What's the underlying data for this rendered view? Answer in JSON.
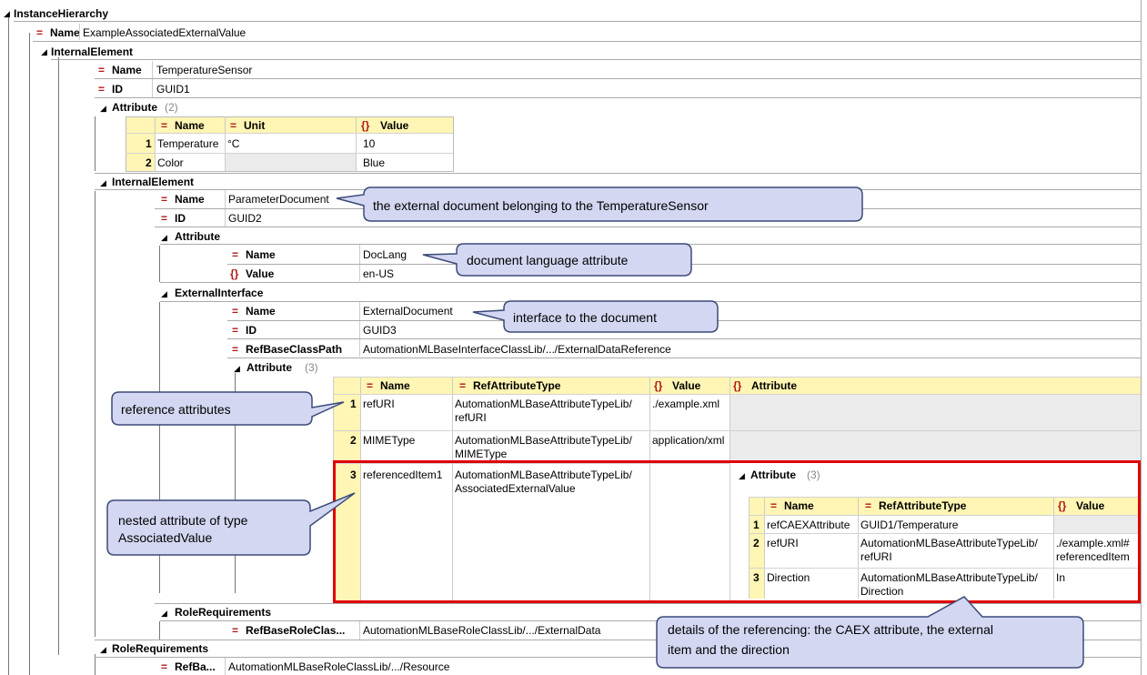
{
  "tree": {
    "root": "InstanceHierarchy",
    "root_name_label": "Name",
    "root_name_value": "ExampleAssociatedExternalValue",
    "ie1": {
      "label": "InternalElement",
      "name_label": "Name",
      "name_value": "TemperatureSensor",
      "id_label": "ID",
      "id_value": "GUID1",
      "attr_label": "Attribute",
      "attr_count": "(2)",
      "attr_table": {
        "headers": [
          "Name",
          "Unit",
          "Value"
        ],
        "rows": [
          {
            "num": "1",
            "name": "Temperature",
            "unit": "°C",
            "value": "10"
          },
          {
            "num": "2",
            "name": "Color",
            "unit": "",
            "value": "Blue"
          }
        ]
      }
    },
    "ie2": {
      "label": "InternalElement",
      "name_label": "Name",
      "name_value": "ParameterDocument",
      "id_label": "ID",
      "id_value": "GUID2",
      "attr_label": "Attribute",
      "attr_name_label": "Name",
      "attr_name_value": "DocLang",
      "attr_value_label": "Value",
      "attr_value_value": "en-US",
      "ext_label": "ExternalInterface",
      "ext_name_label": "Name",
      "ext_name_value": "ExternalDocument",
      "ext_id_label": "ID",
      "ext_id_value": "GUID3",
      "ext_ref_label": "RefBaseClassPath",
      "ext_ref_value": "AutomationMLBaseInterfaceClassLib/.../ExternalDataReference",
      "ext_attr_label": "Attribute",
      "ext_attr_count": "(3)",
      "ref_table": {
        "headers": [
          "Name",
          "RefAttributeType",
          "Value",
          "Attribute"
        ],
        "rows": [
          {
            "num": "1",
            "name": "refURI",
            "type1": "AutomationMLBaseAttributeTypeLib/",
            "type2": "refURI",
            "value": "./example.xml"
          },
          {
            "num": "2",
            "name": "MIMEType",
            "type1": "AutomationMLBaseAttributeTypeLib/",
            "type2": "MIMEType",
            "value": "application/xml"
          },
          {
            "num": "3",
            "name": "referencedItem1",
            "type1": "AutomationMLBaseAttributeTypeLib/",
            "type2": "AssociatedExternalValue",
            "value": ""
          }
        ]
      },
      "nested_attr_label": "Attribute",
      "nested_attr_count": "(3)",
      "nested_table": {
        "headers": [
          "Name",
          "RefAttributeType",
          "Value"
        ],
        "rows": [
          {
            "num": "1",
            "name": "refCAEXAttribute",
            "type1": "GUID1/Temperature",
            "type2": "",
            "value1": "",
            "value2": ""
          },
          {
            "num": "2",
            "name": "refURI",
            "type1": "AutomationMLBaseAttributeTypeLib/",
            "type2": "refURI",
            "value1": "./example.xml#",
            "value2": "referencedItem"
          },
          {
            "num": "3",
            "name": "Direction",
            "type1": "AutomationMLBaseAttributeTypeLib/",
            "type2": "Direction",
            "value1": "In",
            "value2": ""
          }
        ]
      },
      "rolereq_label": "RoleRequirements",
      "rolereq_ref_label": "RefBaseRoleClas...",
      "rolereq_ref_value": "AutomationMLBaseRoleClassLib/.../ExternalData"
    },
    "rolereq2_label": "RoleRequirements",
    "rolereq2_ref_label": "RefBa...",
    "rolereq2_ref_value": "AutomationMLBaseRoleClassLib/.../Resource"
  },
  "callouts": {
    "external_doc": "the external document belonging to the TemperatureSensor",
    "doc_lang": "document language attribute",
    "interface": "interface to the document",
    "reference_attrs": "reference attributes",
    "nested_line1": "nested attribute of type",
    "nested_line2": "AssociatedValue",
    "details_line1": "details of the referencing: the CAEX attribute, the external",
    "details_line2": "item and the direction"
  },
  "colors": {
    "header_yellow": "#fff5b4",
    "row_gray": "#ebebeb",
    "callout_fill": "#d4d7f2",
    "callout_border": "#3c4a78",
    "highlight_red": "#e00000",
    "icon_red": "#b01818"
  },
  "icons": {
    "expand": "collapse-triangle-icon",
    "property": "equals-icon",
    "value": "curly-braces-icon"
  }
}
